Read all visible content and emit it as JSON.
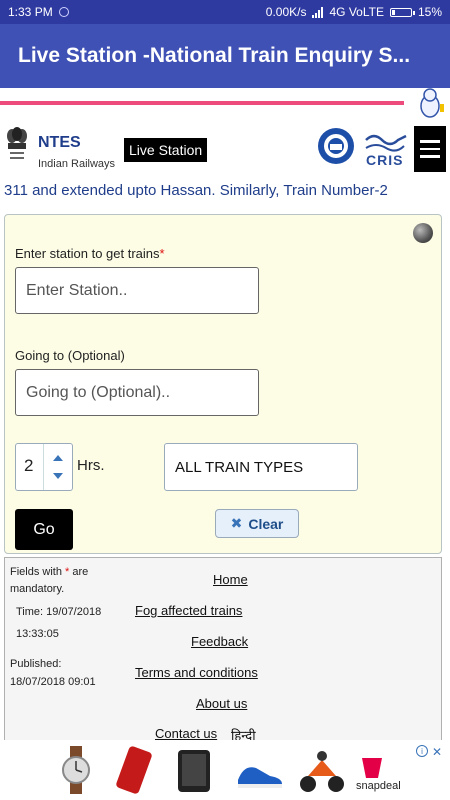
{
  "statusbar": {
    "time": "1:33 PM",
    "speed": "0.00K/s",
    "network": "4G VoLTE",
    "battery": "15%"
  },
  "appbar": {
    "title": "Live Station -National Train Enquiry S..."
  },
  "header": {
    "brand": "NTES",
    "subtitle": "Indian Railways",
    "page_pill": "Live Station",
    "partner": "CRIS"
  },
  "ticker": {
    "text": "311 and extended upto Hassan. Similarly, Train Number-2"
  },
  "form": {
    "station_label": "Enter station to get trains",
    "required_mark": "*",
    "station_placeholder": "Enter Station..",
    "going_label": "Going to (Optional)",
    "going_placeholder": "Going to (Optional)..",
    "hours_value": "2",
    "hours_label": "Hrs.",
    "train_type": "ALL TRAIN TYPES",
    "go_label": "Go",
    "clear_label": "Clear"
  },
  "footer": {
    "fields_note_a": "Fields with",
    "fields_note_mark": "*",
    "fields_note_b": "are mandatory.",
    "time_label": "Time: 19/07/2018",
    "time_value": "13:33:05",
    "published_label": "Published:",
    "published_value": "18/07/2018 09:01",
    "links": [
      "Home",
      "Fog affected trains",
      "Feedback",
      "Terms and conditions",
      "About us",
      "Contact us"
    ],
    "hindi": "हिन्दी"
  },
  "ad": {
    "brand": "snapdeal",
    "close": "✕",
    "info": "i"
  },
  "colors": {
    "statusbar": "#2f3aa1",
    "appbar": "#3f51b5",
    "accent_line": "#ec4b7c",
    "panel_bg": "#fdfde6",
    "link_blue": "#1f3d8a"
  }
}
